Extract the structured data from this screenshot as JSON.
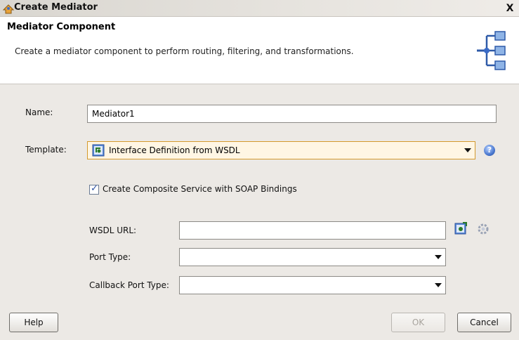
{
  "window": {
    "title": "Create Mediator",
    "close_glyph": "X"
  },
  "header": {
    "title": "Mediator Component",
    "description": "Create a mediator component to perform routing, filtering, and transformations.",
    "icon": "mediator-routing-icon"
  },
  "form": {
    "name_label": "Name:",
    "name_value": "Mediator1",
    "template_label": "Template:",
    "template_value": "Interface Definition from WSDL",
    "checkbox_label": "Create Composite Service with SOAP Bindings",
    "checkbox_checked": true,
    "wsdl_url_label": "WSDL URL:",
    "wsdl_url_value": "",
    "port_type_label": "Port Type:",
    "port_type_value": "",
    "callback_port_type_label": "Callback Port Type:",
    "callback_port_type_value": ""
  },
  "buttons": {
    "help": "Help",
    "ok": "OK",
    "cancel": "Cancel"
  },
  "colors": {
    "accent": "#d49a2d",
    "dialog_bg": "#ece9e5",
    "header_bg": "#ffffff"
  }
}
